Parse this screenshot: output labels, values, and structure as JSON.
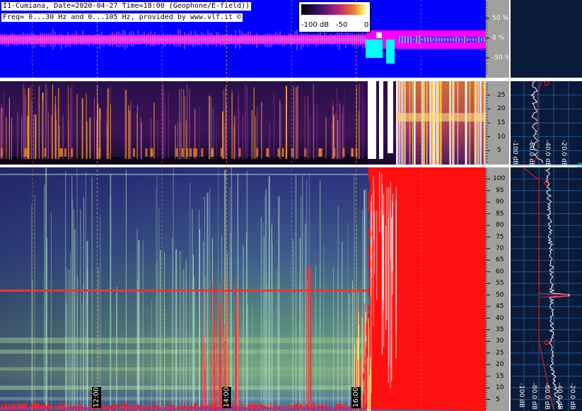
{
  "header": {
    "line1": "I1-Cumiana, Date=2020-04-27 Time=18:00 (Geophone/E-field))",
    "line2": "Freq= 0...30 Hz and 0...105 Hz, provided by www.vlf.it ©"
  },
  "colorbar": {
    "labels": [
      "-100 dB",
      "-50",
      "0"
    ],
    "colors": [
      "#000000",
      "#2a0a5a",
      "#7a1a7a",
      "#c8306a",
      "#f08030",
      "#ffe060",
      "#ffffff"
    ]
  },
  "colors": {
    "amplitude_bg": "#0000ff",
    "amplitude_trace": "#ff00ff",
    "saturation": "#00ffff",
    "noise_burst": "#ff0000",
    "spectrum_panel_bg": "#0a1a3a",
    "grid": "#3aa0e0",
    "axis_bg": "#a0a0a0"
  },
  "chart_data": [
    {
      "type": "line",
      "panel": "amplitude",
      "ylabel_ticks": [
        "50 %",
        "0 %",
        "-50 %"
      ],
      "yticks": [
        50,
        0,
        -50
      ],
      "ylim": [
        -100,
        100
      ]
    },
    {
      "type": "heatmap",
      "panel": "spectrogram-low",
      "yticks": [
        5,
        10,
        15,
        20,
        25
      ],
      "ylim": [
        0,
        30
      ],
      "y_unit": "Hz"
    },
    {
      "type": "heatmap",
      "panel": "spectrogram-high",
      "yticks": [
        5,
        10,
        15,
        20,
        25,
        30,
        35,
        40,
        45,
        50,
        55,
        60,
        65,
        70,
        75,
        80,
        85,
        90,
        95,
        100
      ],
      "ylim": [
        0,
        105
      ],
      "y_unit": "Hz",
      "xticks": [
        "12:00",
        "14:00",
        "16:00"
      ],
      "xlim": [
        "10:30",
        "18:00"
      ]
    },
    {
      "type": "line",
      "panel": "spectrum-low",
      "db_labels": [
        "-100 dB",
        "-60.0 dB",
        "-40.0 dB",
        "-20.0 dB"
      ],
      "ylim": [
        0,
        30
      ]
    },
    {
      "type": "line",
      "panel": "spectrum-high",
      "db_labels": [
        "-100 dB",
        "-80.0 dB",
        "-60.0 dB",
        "-40.0 dB",
        "-20.0 dB"
      ],
      "ylim": [
        0,
        105
      ],
      "peak_hz": 50
    }
  ]
}
